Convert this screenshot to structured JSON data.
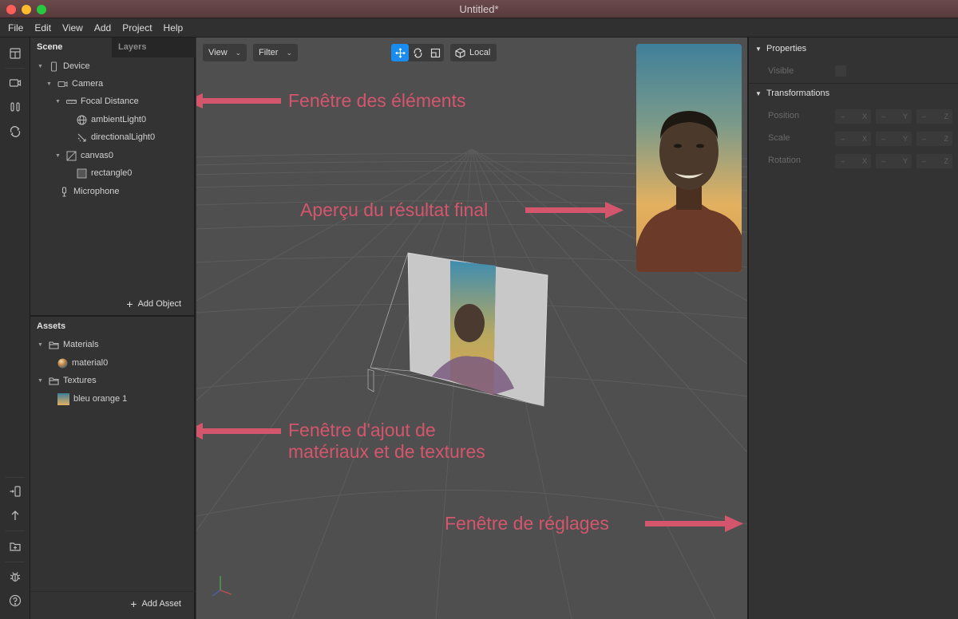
{
  "window": {
    "title": "Untitled*"
  },
  "menu": [
    "File",
    "Edit",
    "View",
    "Add",
    "Project",
    "Help"
  ],
  "toolstrip": {
    "top": [
      "layout-icon",
      "video-camera-icon",
      "pause-columns-icon",
      "sync-icon"
    ],
    "bottom": [
      "send-to-device-icon",
      "upload-arrow-icon",
      "add-folder-icon",
      "bug-icon",
      "help-icon"
    ]
  },
  "scene_panel": {
    "tabs": [
      {
        "label": "Scene",
        "active": true
      },
      {
        "label": "Layers",
        "active": false
      }
    ],
    "tree": [
      {
        "label": "Device",
        "icon": "phone-icon",
        "expanded": true,
        "depth": 0
      },
      {
        "label": "Camera",
        "icon": "camera-icon",
        "expanded": true,
        "depth": 1
      },
      {
        "label": "Focal Distance",
        "icon": "ruler-icon",
        "expanded": true,
        "depth": 2
      },
      {
        "label": "ambientLight0",
        "icon": "globe-icon",
        "depth": 3
      },
      {
        "label": "directionalLight0",
        "icon": "directional-light-icon",
        "depth": 3
      },
      {
        "label": "canvas0",
        "icon": "canvas-icon",
        "expanded": true,
        "depth": 2
      },
      {
        "label": "rectangle0",
        "icon": "rectangle-icon",
        "depth": 3
      },
      {
        "label": "Microphone",
        "icon": "microphone-icon",
        "depth": 1
      }
    ],
    "add_object_label": "Add Object"
  },
  "assets_panel": {
    "title": "Assets",
    "tree": [
      {
        "label": "Materials",
        "icon": "folder-icon",
        "expanded": true,
        "depth": 0
      },
      {
        "label": "material0",
        "icon": "material-sphere-icon",
        "depth": 1
      },
      {
        "label": "Textures",
        "icon": "folder-icon",
        "expanded": true,
        "depth": 0
      },
      {
        "label": "bleu orange 1",
        "icon": "texture-thumbnail-icon",
        "depth": 1
      }
    ],
    "add_asset_label": "Add Asset"
  },
  "viewport": {
    "view_dropdown": "View",
    "filter_dropdown": "Filter",
    "transform_tools": [
      {
        "name": "move",
        "active": true
      },
      {
        "name": "rotate",
        "active": false
      },
      {
        "name": "scale",
        "active": false
      }
    ],
    "space_button": "Local"
  },
  "annotations": {
    "color": "#d4566d",
    "elements": "Fenêtre des éléments",
    "preview": "Aperçu du résultat final",
    "assets_line1": "Fenêtre d'ajout de",
    "assets_line2": "matériaux et de textures",
    "settings": "Fenêtre de réglages"
  },
  "inspector": {
    "properties_title": "Properties",
    "visible_label": "Visible",
    "visible_checked": false,
    "transformations_title": "Transformations",
    "rows": [
      {
        "label": "Position",
        "x": "–",
        "y": "–",
        "z": "–"
      },
      {
        "label": "Scale",
        "x": "–",
        "y": "–",
        "z": "–"
      },
      {
        "label": "Rotation",
        "x": "–",
        "y": "–",
        "z": "–"
      }
    ],
    "axis_labels": [
      "X",
      "Y",
      "Z"
    ]
  },
  "colors": {
    "accent": "#1a8cf0",
    "annotation": "#d4566d"
  }
}
